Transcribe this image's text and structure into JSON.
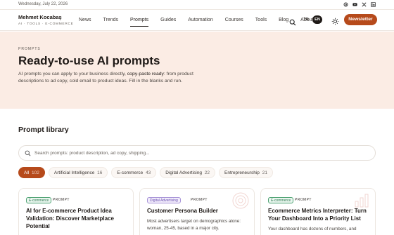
{
  "top": {
    "date": "Wednesday, July 22, 2026",
    "socials": [
      "threads-icon",
      "youtube-icon",
      "x-icon",
      "linkedin-icon"
    ]
  },
  "brand": {
    "name": "Mehmet Kocabaş",
    "tagline": "AI · TOOLS · E-COMMERCE"
  },
  "nav": {
    "items": [
      "News",
      "Trends",
      "Prompts",
      "Guides",
      "Automation",
      "Courses",
      "Tools",
      "Blog",
      "About"
    ],
    "active": "Prompts"
  },
  "lang": {
    "tr": "TR",
    "en": "EN",
    "selected": "EN"
  },
  "newsletter_label": "Newsletter",
  "hero": {
    "eyebrow": "PROMPTS",
    "title": "Ready-to-use AI prompts",
    "desc_pre": "AI prompts you can apply to your business directly, ",
    "desc_bold": "copy-paste ready",
    "desc_post": ": from product descriptions to ad copy, cold email to product ideas. Fill in the blanks and run."
  },
  "library": {
    "title": "Prompt library",
    "search_placeholder": "Search prompts: product description, ad copy, shipping...",
    "chips": [
      {
        "label": "All",
        "count": "102",
        "active": true
      },
      {
        "label": "Artificial Intelligence",
        "count": "16",
        "active": false
      },
      {
        "label": "E-commerce",
        "count": "43",
        "active": false
      },
      {
        "label": "Digital Advertising",
        "count": "22",
        "active": false
      },
      {
        "label": "Entrepreneurship",
        "count": "21",
        "active": false
      }
    ]
  },
  "cards": [
    {
      "category": "E-commerce",
      "kind": "PROMPT",
      "title": "AI for E-commerce Product Idea Validation: Discover Marketplace Potential",
      "desc": ""
    },
    {
      "category": "Digital Advertising",
      "kind": "PROMPT",
      "title": "Customer Persona Builder",
      "desc": "Most advertisers target on demographics alone: woman, 25-45, based in a major city."
    },
    {
      "category": "E-commerce",
      "kind": "PROMPT",
      "title": "Ecommerce Metrics Interpreter: Turn Your Dashboard Into a Priority List",
      "desc": "Your dashboard has dozens of numbers, and"
    }
  ],
  "colors": {
    "accent": "#b64a1b",
    "hero_bg": "#fbece4",
    "text": "#1f1a17"
  }
}
